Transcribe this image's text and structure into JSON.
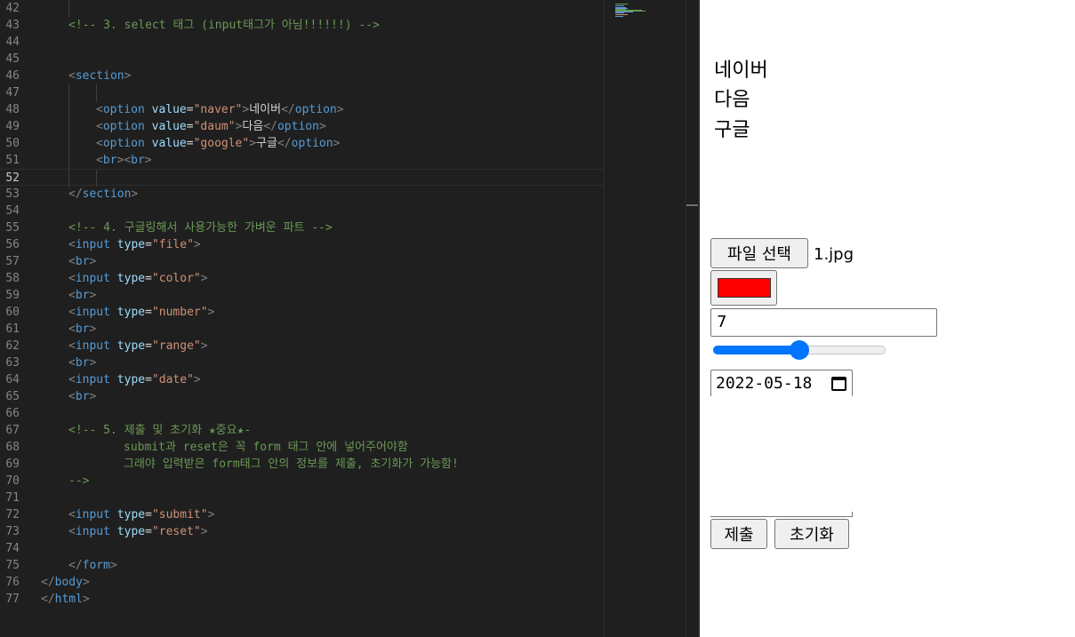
{
  "editor": {
    "lines": [
      {
        "n": "42",
        "tokens": []
      },
      {
        "n": "43",
        "tokens": [
          [
            "comment",
            "<!-- 3. select 태그 (input태그가 아님!!!!!!) -->"
          ]
        ]
      },
      {
        "n": "44",
        "tokens": []
      },
      {
        "n": "45",
        "tokens": []
      },
      {
        "n": "46",
        "tokens": [
          [
            "bracket",
            "<"
          ],
          [
            "tag",
            "section"
          ],
          [
            "bracket",
            ">"
          ]
        ]
      },
      {
        "n": "47",
        "tokens": []
      },
      {
        "n": "48",
        "tokens": [
          [
            "bracket",
            "<"
          ],
          [
            "tag",
            "option"
          ],
          [
            "text",
            " "
          ],
          [
            "attr",
            "value"
          ],
          [
            "text",
            "="
          ],
          [
            "str",
            "\"naver\""
          ],
          [
            "bracket",
            ">"
          ],
          [
            "text",
            "네이버"
          ],
          [
            "bracket",
            "</"
          ],
          [
            "tag",
            "option"
          ],
          [
            "bracket",
            ">"
          ]
        ]
      },
      {
        "n": "49",
        "tokens": [
          [
            "bracket",
            "<"
          ],
          [
            "tag",
            "option"
          ],
          [
            "text",
            " "
          ],
          [
            "attr",
            "value"
          ],
          [
            "text",
            "="
          ],
          [
            "str",
            "\"daum\""
          ],
          [
            "bracket",
            ">"
          ],
          [
            "text",
            "다음"
          ],
          [
            "bracket",
            "</"
          ],
          [
            "tag",
            "option"
          ],
          [
            "bracket",
            ">"
          ]
        ]
      },
      {
        "n": "50",
        "tokens": [
          [
            "bracket",
            "<"
          ],
          [
            "tag",
            "option"
          ],
          [
            "text",
            " "
          ],
          [
            "attr",
            "value"
          ],
          [
            "text",
            "="
          ],
          [
            "str",
            "\"google\""
          ],
          [
            "bracket",
            ">"
          ],
          [
            "text",
            "구글"
          ],
          [
            "bracket",
            "</"
          ],
          [
            "tag",
            "option"
          ],
          [
            "bracket",
            ">"
          ]
        ]
      },
      {
        "n": "51",
        "tokens": [
          [
            "bracket",
            "<"
          ],
          [
            "tag",
            "br"
          ],
          [
            "bracket",
            "><"
          ],
          [
            "tag",
            "br"
          ],
          [
            "bracket",
            ">"
          ]
        ]
      },
      {
        "n": "52",
        "tokens": []
      },
      {
        "n": "53",
        "tokens": [
          [
            "bracket",
            "</"
          ],
          [
            "tag",
            "section"
          ],
          [
            "bracket",
            ">"
          ]
        ]
      },
      {
        "n": "54",
        "tokens": []
      },
      {
        "n": "55",
        "tokens": [
          [
            "comment",
            "<!-- 4. 구글링해서 사용가능한 가벼운 파트 -->"
          ]
        ]
      },
      {
        "n": "56",
        "tokens": [
          [
            "bracket",
            "<"
          ],
          [
            "tag",
            "input"
          ],
          [
            "text",
            " "
          ],
          [
            "attr",
            "type"
          ],
          [
            "text",
            "="
          ],
          [
            "str",
            "\"file\""
          ],
          [
            "bracket",
            ">"
          ]
        ]
      },
      {
        "n": "57",
        "tokens": [
          [
            "bracket",
            "<"
          ],
          [
            "tag",
            "br"
          ],
          [
            "bracket",
            ">"
          ]
        ]
      },
      {
        "n": "58",
        "tokens": [
          [
            "bracket",
            "<"
          ],
          [
            "tag",
            "input"
          ],
          [
            "text",
            " "
          ],
          [
            "attr",
            "type"
          ],
          [
            "text",
            "="
          ],
          [
            "str",
            "\"color\""
          ],
          [
            "bracket",
            ">"
          ]
        ]
      },
      {
        "n": "59",
        "tokens": [
          [
            "bracket",
            "<"
          ],
          [
            "tag",
            "br"
          ],
          [
            "bracket",
            ">"
          ]
        ]
      },
      {
        "n": "60",
        "tokens": [
          [
            "bracket",
            "<"
          ],
          [
            "tag",
            "input"
          ],
          [
            "text",
            " "
          ],
          [
            "attr",
            "type"
          ],
          [
            "text",
            "="
          ],
          [
            "str",
            "\"number\""
          ],
          [
            "bracket",
            ">"
          ]
        ]
      },
      {
        "n": "61",
        "tokens": [
          [
            "bracket",
            "<"
          ],
          [
            "tag",
            "br"
          ],
          [
            "bracket",
            ">"
          ]
        ]
      },
      {
        "n": "62",
        "tokens": [
          [
            "bracket",
            "<"
          ],
          [
            "tag",
            "input"
          ],
          [
            "text",
            " "
          ],
          [
            "attr",
            "type"
          ],
          [
            "text",
            "="
          ],
          [
            "str",
            "\"range\""
          ],
          [
            "bracket",
            ">"
          ]
        ]
      },
      {
        "n": "63",
        "tokens": [
          [
            "bracket",
            "<"
          ],
          [
            "tag",
            "br"
          ],
          [
            "bracket",
            ">"
          ]
        ]
      },
      {
        "n": "64",
        "tokens": [
          [
            "bracket",
            "<"
          ],
          [
            "tag",
            "input"
          ],
          [
            "text",
            " "
          ],
          [
            "attr",
            "type"
          ],
          [
            "text",
            "="
          ],
          [
            "str",
            "\"date\""
          ],
          [
            "bracket",
            ">"
          ]
        ]
      },
      {
        "n": "65",
        "tokens": [
          [
            "bracket",
            "<"
          ],
          [
            "tag",
            "br"
          ],
          [
            "bracket",
            ">"
          ]
        ]
      },
      {
        "n": "66",
        "tokens": []
      },
      {
        "n": "67",
        "tokens": [
          [
            "comment",
            "<!-- 5. 제출 및 초기화 ★중요★-"
          ]
        ]
      },
      {
        "n": "68",
        "tokens": [
          [
            "comment",
            "submit과 reset은 꼭 form 태그 안에 넣어주어야함"
          ]
        ]
      },
      {
        "n": "69",
        "tokens": [
          [
            "comment",
            "그래야 입력받은 form태그 안의 정보를 제출, 초기화가 가능함!"
          ]
        ]
      },
      {
        "n": "70",
        "tokens": [
          [
            "comment",
            "-->"
          ]
        ]
      },
      {
        "n": "71",
        "tokens": []
      },
      {
        "n": "72",
        "tokens": [
          [
            "bracket",
            "<"
          ],
          [
            "tag",
            "input"
          ],
          [
            "text",
            " "
          ],
          [
            "attr",
            "type"
          ],
          [
            "text",
            "="
          ],
          [
            "str",
            "\"submit\""
          ],
          [
            "bracket",
            ">"
          ]
        ]
      },
      {
        "n": "73",
        "tokens": [
          [
            "bracket",
            "<"
          ],
          [
            "tag",
            "input"
          ],
          [
            "text",
            " "
          ],
          [
            "attr",
            "type"
          ],
          [
            "text",
            "="
          ],
          [
            "str",
            "\"reset\""
          ],
          [
            "bracket",
            ">"
          ]
        ]
      },
      {
        "n": "74",
        "tokens": []
      },
      {
        "n": "75",
        "tokens": [
          [
            "bracket",
            "</"
          ],
          [
            "tag",
            "form"
          ],
          [
            "bracket",
            ">"
          ]
        ]
      },
      {
        "n": "76",
        "tokens": [
          [
            "bracket",
            "</"
          ],
          [
            "tag",
            "body"
          ],
          [
            "bracket",
            ">"
          ]
        ]
      },
      {
        "n": "77",
        "tokens": [
          [
            "bracket",
            "</"
          ],
          [
            "tag",
            "html"
          ],
          [
            "bracket",
            ">"
          ]
        ]
      }
    ],
    "current_line": "52",
    "colors": {
      "comment": "#6a9955",
      "tag": "#569cd6",
      "attr": "#9cdcfe",
      "str": "#ce9178",
      "text": "#d4d4d4",
      "bracket": "#808080",
      "background": "#1f1f1f"
    }
  },
  "preview": {
    "options": [
      "네이버",
      "다음",
      "구글"
    ],
    "file_button_label": "파일 선택",
    "file_name": "1.jpg",
    "color_value": "#ff0000",
    "number_value": "7",
    "range_fraction": 0.5,
    "date_value": "2022-05-18",
    "submit_label": "제출",
    "reset_label": "초기화",
    "accent_color": "#0075ff"
  }
}
